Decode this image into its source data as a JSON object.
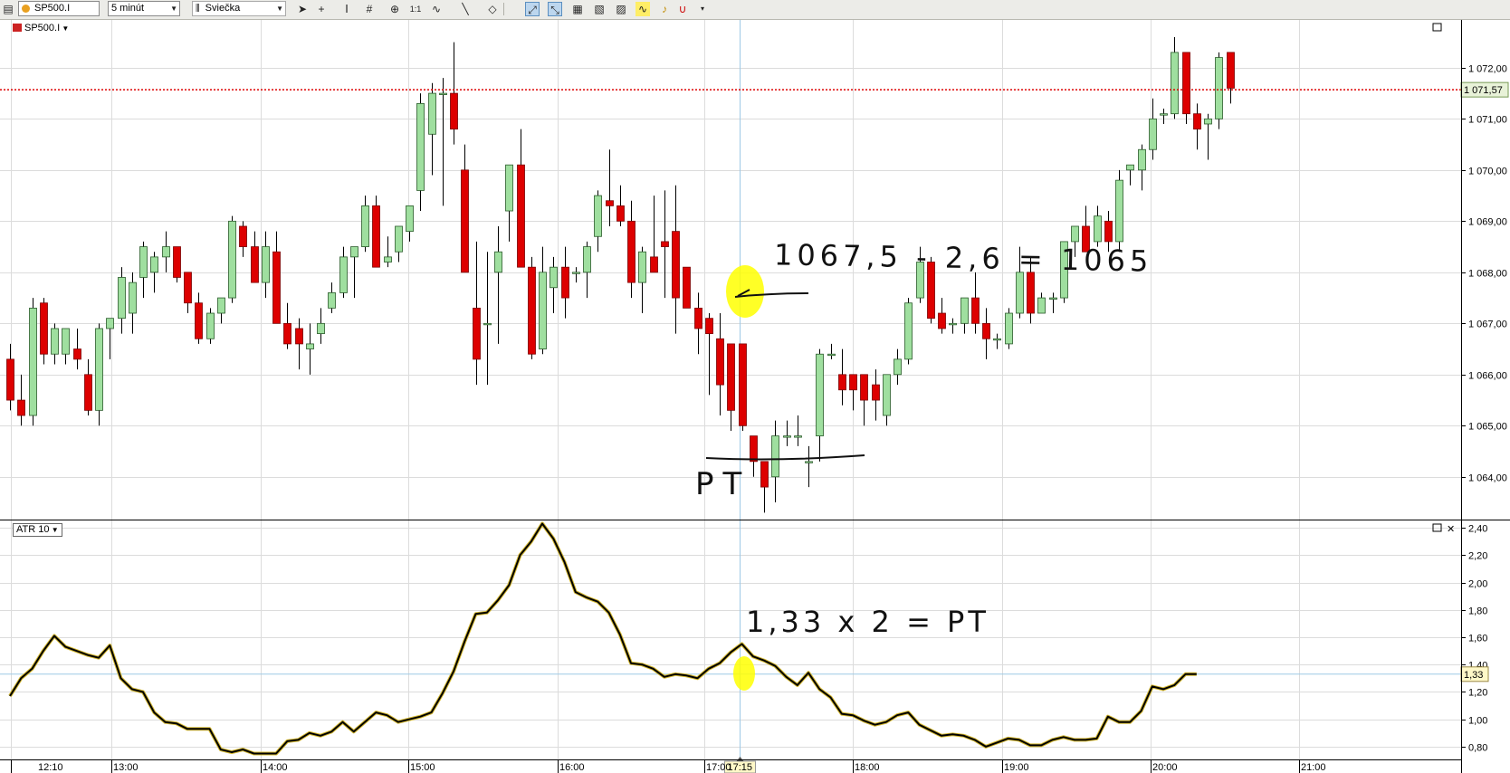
{
  "toolbar": {
    "symbol": "SP500.I",
    "timeframe": "5 minút",
    "chart_style": "Sviečka",
    "icons": [
      "ticket-icon",
      "cursor-icon",
      "crosshair-icon",
      "text-tool-icon",
      "grid-icon",
      "zoom-icon",
      "one-to-one-icon",
      "indicator-icon",
      "line-tool-icon",
      "eraser-icon",
      "auto-scale-icon",
      "auto-fit-icon",
      "template-icon",
      "compare-icon",
      "properties-icon",
      "indicator-list-icon",
      "alert-bell-icon",
      "magnet-icon",
      "more-icon"
    ]
  },
  "colors": {
    "bull": "#9fdf9f",
    "bear": "#dd0000",
    "price_line": "#dd0000",
    "crosshair": "#9ec9e6",
    "atr_line": "#d4b830",
    "highlight": "#ffff00",
    "grid": "#dcdcdc"
  },
  "price_pane": {
    "legend": "SP500.I",
    "last_price_label": "1 071,57",
    "handwriting_1": "1067,5 - 2,6 = 1065",
    "handwriting_2": "PT"
  },
  "atr_pane": {
    "legend": "ATR 10",
    "last_value_label": "1,33",
    "handwriting": "1,33 x 2 = PT"
  },
  "cursor_time_label": "17:15",
  "chart_data": [
    {
      "type": "candlestick",
      "title": "SP500.I",
      "timeframe": "5 minút",
      "x_ticks": [
        "12:10",
        "13:00",
        "14:00",
        "15:00",
        "16:00",
        "17:00",
        "18:00",
        "19:00",
        "20:00",
        "21:00"
      ],
      "ylim": [
        1063.2,
        1072.9
      ],
      "y_ticks": [
        "1 072,00",
        "1 071,00",
        "1 070,00",
        "1 069,00",
        "1 068,00",
        "1 067,00",
        "1 066,00",
        "1 065,00",
        "1 064,00"
      ],
      "y_tick_values": [
        1072,
        1071,
        1070,
        1069,
        1068,
        1067,
        1066,
        1065,
        1064
      ],
      "last_price": 1071.57,
      "crosshair_time": "17:15",
      "candles": [
        {
          "o": 1066.3,
          "h": 1066.6,
          "l": 1065.3,
          "c": 1065.5
        },
        {
          "o": 1065.5,
          "h": 1066.0,
          "l": 1065.0,
          "c": 1065.2
        },
        {
          "o": 1065.2,
          "h": 1067.5,
          "l": 1065.0,
          "c": 1067.3
        },
        {
          "o": 1067.4,
          "h": 1067.5,
          "l": 1066.2,
          "c": 1066.4
        },
        {
          "o": 1066.4,
          "h": 1067.0,
          "l": 1066.2,
          "c": 1066.9
        },
        {
          "o": 1066.4,
          "h": 1066.9,
          "l": 1066.2,
          "c": 1066.9
        },
        {
          "o": 1066.5,
          "h": 1066.9,
          "l": 1066.1,
          "c": 1066.3
        },
        {
          "o": 1066.0,
          "h": 1066.3,
          "l": 1065.2,
          "c": 1065.3
        },
        {
          "o": 1065.3,
          "h": 1067.0,
          "l": 1065.0,
          "c": 1066.9
        },
        {
          "o": 1066.9,
          "h": 1067.1,
          "l": 1066.3,
          "c": 1067.1
        },
        {
          "o": 1067.1,
          "h": 1068.1,
          "l": 1066.8,
          "c": 1067.9
        },
        {
          "o": 1067.2,
          "h": 1068.0,
          "l": 1066.8,
          "c": 1067.8
        },
        {
          "o": 1067.9,
          "h": 1068.6,
          "l": 1067.5,
          "c": 1068.5
        },
        {
          "o": 1068.0,
          "h": 1068.4,
          "l": 1067.6,
          "c": 1068.3
        },
        {
          "o": 1068.3,
          "h": 1068.8,
          "l": 1068.0,
          "c": 1068.5
        },
        {
          "o": 1068.5,
          "h": 1068.5,
          "l": 1067.8,
          "c": 1067.9
        },
        {
          "o": 1068.0,
          "h": 1068.0,
          "l": 1067.2,
          "c": 1067.4
        },
        {
          "o": 1067.4,
          "h": 1067.6,
          "l": 1066.6,
          "c": 1066.7
        },
        {
          "o": 1066.7,
          "h": 1067.3,
          "l": 1066.6,
          "c": 1067.2
        },
        {
          "o": 1067.2,
          "h": 1067.5,
          "l": 1067.0,
          "c": 1067.5
        },
        {
          "o": 1067.5,
          "h": 1069.1,
          "l": 1067.4,
          "c": 1069.0
        },
        {
          "o": 1068.9,
          "h": 1069.0,
          "l": 1068.3,
          "c": 1068.5
        },
        {
          "o": 1068.5,
          "h": 1068.8,
          "l": 1067.8,
          "c": 1067.8
        },
        {
          "o": 1067.8,
          "h": 1068.8,
          "l": 1067.5,
          "c": 1068.5
        },
        {
          "o": 1068.4,
          "h": 1068.8,
          "l": 1067.0,
          "c": 1067.0
        },
        {
          "o": 1067.0,
          "h": 1067.4,
          "l": 1066.5,
          "c": 1066.6
        },
        {
          "o": 1066.9,
          "h": 1067.1,
          "l": 1066.1,
          "c": 1066.6
        },
        {
          "o": 1066.5,
          "h": 1067.0,
          "l": 1066.0,
          "c": 1066.6
        },
        {
          "o": 1066.8,
          "h": 1067.3,
          "l": 1066.6,
          "c": 1067.0
        },
        {
          "o": 1067.3,
          "h": 1067.8,
          "l": 1067.2,
          "c": 1067.6
        },
        {
          "o": 1067.6,
          "h": 1068.5,
          "l": 1067.5,
          "c": 1068.3
        },
        {
          "o": 1068.3,
          "h": 1068.5,
          "l": 1067.5,
          "c": 1068.5
        },
        {
          "o": 1068.5,
          "h": 1069.5,
          "l": 1068.4,
          "c": 1069.3
        },
        {
          "o": 1069.3,
          "h": 1069.5,
          "l": 1068.4,
          "c": 1068.1
        },
        {
          "o": 1068.2,
          "h": 1068.7,
          "l": 1068.1,
          "c": 1068.3
        },
        {
          "o": 1068.4,
          "h": 1068.9,
          "l": 1068.2,
          "c": 1068.9
        },
        {
          "o": 1068.8,
          "h": 1069.3,
          "l": 1068.6,
          "c": 1069.3
        },
        {
          "o": 1069.6,
          "h": 1071.5,
          "l": 1069.2,
          "c": 1071.3
        },
        {
          "o": 1070.7,
          "h": 1071.7,
          "l": 1069.9,
          "c": 1071.5
        },
        {
          "o": 1071.5,
          "h": 1071.8,
          "l": 1069.3,
          "c": 1071.5
        },
        {
          "o": 1071.5,
          "h": 1072.5,
          "l": 1070.5,
          "c": 1070.8
        },
        {
          "o": 1070.0,
          "h": 1070.5,
          "l": 1068.0,
          "c": 1068.0
        },
        {
          "o": 1067.3,
          "h": 1068.6,
          "l": 1065.8,
          "c": 1066.3
        },
        {
          "o": 1067.0,
          "h": 1068.4,
          "l": 1065.8,
          "c": 1067.0
        },
        {
          "o": 1068.0,
          "h": 1068.9,
          "l": 1066.6,
          "c": 1068.4
        },
        {
          "o": 1069.2,
          "h": 1070.0,
          "l": 1068.6,
          "c": 1070.1
        },
        {
          "o": 1070.1,
          "h": 1070.8,
          "l": 1068.4,
          "c": 1068.1
        },
        {
          "o": 1068.1,
          "h": 1068.3,
          "l": 1066.3,
          "c": 1066.4
        },
        {
          "o": 1066.5,
          "h": 1068.5,
          "l": 1066.4,
          "c": 1068.0
        },
        {
          "o": 1067.7,
          "h": 1068.3,
          "l": 1067.2,
          "c": 1068.1
        },
        {
          "o": 1068.1,
          "h": 1068.5,
          "l": 1067.1,
          "c": 1067.5
        },
        {
          "o": 1068.0,
          "h": 1068.1,
          "l": 1067.8,
          "c": 1068.0
        },
        {
          "o": 1068.0,
          "h": 1068.6,
          "l": 1067.5,
          "c": 1068.5
        },
        {
          "o": 1068.7,
          "h": 1069.6,
          "l": 1068.4,
          "c": 1069.5
        },
        {
          "o": 1069.4,
          "h": 1070.4,
          "l": 1068.9,
          "c": 1069.3
        },
        {
          "o": 1069.3,
          "h": 1069.7,
          "l": 1068.9,
          "c": 1069.0
        },
        {
          "o": 1069.0,
          "h": 1069.4,
          "l": 1067.5,
          "c": 1067.8
        },
        {
          "o": 1067.8,
          "h": 1068.5,
          "l": 1067.2,
          "c": 1068.4
        },
        {
          "o": 1068.3,
          "h": 1069.5,
          "l": 1068.1,
          "c": 1068.0
        },
        {
          "o": 1068.6,
          "h": 1069.6,
          "l": 1067.5,
          "c": 1068.5
        },
        {
          "o": 1068.8,
          "h": 1069.7,
          "l": 1066.8,
          "c": 1067.5
        },
        {
          "o": 1068.1,
          "h": 1068.0,
          "l": 1067.3,
          "c": 1067.3
        },
        {
          "o": 1067.3,
          "h": 1067.6,
          "l": 1066.4,
          "c": 1066.9
        },
        {
          "o": 1067.1,
          "h": 1067.2,
          "l": 1065.6,
          "c": 1066.8
        },
        {
          "o": 1066.7,
          "h": 1067.2,
          "l": 1065.2,
          "c": 1065.8
        },
        {
          "o": 1066.6,
          "h": 1066.6,
          "l": 1064.9,
          "c": 1065.3
        },
        {
          "o": 1066.6,
          "h": 1066.6,
          "l": 1064.9,
          "c": 1065.0
        },
        {
          "o": 1064.8,
          "h": 1064.8,
          "l": 1064.0,
          "c": 1064.3
        },
        {
          "o": 1064.3,
          "h": 1064.3,
          "l": 1063.3,
          "c": 1063.8
        },
        {
          "o": 1064.0,
          "h": 1065.1,
          "l": 1063.5,
          "c": 1064.8
        },
        {
          "o": 1064.8,
          "h": 1065.1,
          "l": 1064.6,
          "c": 1064.8
        },
        {
          "o": 1064.8,
          "h": 1065.2,
          "l": 1064.6,
          "c": 1064.8
        },
        {
          "o": 1064.3,
          "h": 1064.6,
          "l": 1063.8,
          "c": 1064.3
        },
        {
          "o": 1064.8,
          "h": 1066.5,
          "l": 1064.3,
          "c": 1066.4
        },
        {
          "o": 1066.4,
          "h": 1066.6,
          "l": 1066.3,
          "c": 1066.4
        },
        {
          "o": 1066.0,
          "h": 1066.5,
          "l": 1065.4,
          "c": 1065.7
        },
        {
          "o": 1066.0,
          "h": 1066.0,
          "l": 1065.3,
          "c": 1065.7
        },
        {
          "o": 1066.0,
          "h": 1066.0,
          "l": 1065.0,
          "c": 1065.5
        },
        {
          "o": 1065.8,
          "h": 1066.1,
          "l": 1065.1,
          "c": 1065.5
        },
        {
          "o": 1065.2,
          "h": 1066.0,
          "l": 1065.0,
          "c": 1066.0
        },
        {
          "o": 1066.0,
          "h": 1066.5,
          "l": 1065.8,
          "c": 1066.3
        },
        {
          "o": 1066.3,
          "h": 1067.5,
          "l": 1066.2,
          "c": 1067.4
        },
        {
          "o": 1067.5,
          "h": 1068.5,
          "l": 1067.4,
          "c": 1068.2
        },
        {
          "o": 1068.2,
          "h": 1068.3,
          "l": 1067.0,
          "c": 1067.1
        },
        {
          "o": 1067.2,
          "h": 1067.5,
          "l": 1066.8,
          "c": 1066.9
        },
        {
          "o": 1067.0,
          "h": 1067.1,
          "l": 1066.8,
          "c": 1067.0
        },
        {
          "o": 1067.0,
          "h": 1067.5,
          "l": 1066.8,
          "c": 1067.5
        },
        {
          "o": 1067.5,
          "h": 1068.0,
          "l": 1066.8,
          "c": 1067.0
        },
        {
          "o": 1067.0,
          "h": 1067.3,
          "l": 1066.3,
          "c": 1066.7
        },
        {
          "o": 1066.7,
          "h": 1066.8,
          "l": 1066.5,
          "c": 1066.7
        },
        {
          "o": 1066.6,
          "h": 1067.3,
          "l": 1066.5,
          "c": 1067.2
        },
        {
          "o": 1067.2,
          "h": 1068.5,
          "l": 1067.1,
          "c": 1068.0
        },
        {
          "o": 1068.0,
          "h": 1068.3,
          "l": 1067.0,
          "c": 1067.2
        },
        {
          "o": 1067.2,
          "h": 1067.6,
          "l": 1067.2,
          "c": 1067.5
        },
        {
          "o": 1067.5,
          "h": 1067.6,
          "l": 1067.2,
          "c": 1067.5
        },
        {
          "o": 1067.5,
          "h": 1068.6,
          "l": 1067.4,
          "c": 1068.6
        },
        {
          "o": 1068.6,
          "h": 1068.9,
          "l": 1068.3,
          "c": 1068.9
        },
        {
          "o": 1068.9,
          "h": 1069.3,
          "l": 1068.4,
          "c": 1068.4
        },
        {
          "o": 1068.6,
          "h": 1069.3,
          "l": 1068.5,
          "c": 1069.1
        },
        {
          "o": 1069.0,
          "h": 1069.2,
          "l": 1068.4,
          "c": 1068.6
        },
        {
          "o": 1068.6,
          "h": 1070.0,
          "l": 1068.4,
          "c": 1069.8
        },
        {
          "o": 1070.0,
          "h": 1070.1,
          "l": 1069.7,
          "c": 1070.1
        },
        {
          "o": 1070.0,
          "h": 1070.5,
          "l": 1069.6,
          "c": 1070.4
        },
        {
          "o": 1070.4,
          "h": 1071.4,
          "l": 1070.2,
          "c": 1071.0
        },
        {
          "o": 1071.1,
          "h": 1071.2,
          "l": 1070.9,
          "c": 1071.1
        },
        {
          "o": 1071.1,
          "h": 1072.6,
          "l": 1071.0,
          "c": 1072.3
        },
        {
          "o": 1072.3,
          "h": 1072.3,
          "l": 1070.9,
          "c": 1071.1
        },
        {
          "o": 1071.1,
          "h": 1071.3,
          "l": 1070.4,
          "c": 1070.8
        },
        {
          "o": 1070.9,
          "h": 1071.1,
          "l": 1070.2,
          "c": 1071.0
        },
        {
          "o": 1071.0,
          "h": 1072.3,
          "l": 1070.8,
          "c": 1072.2
        },
        {
          "o": 1072.3,
          "h": 1072.3,
          "l": 1071.3,
          "c": 1071.6
        }
      ]
    },
    {
      "type": "line",
      "title": "ATR 10",
      "ylim": [
        0.74,
        2.44
      ],
      "y_ticks": [
        "2,40",
        "2,20",
        "2,00",
        "1,80",
        "1,60",
        "1,40",
        "1,20",
        "1,00",
        "0,80"
      ],
      "y_tick_values": [
        2.4,
        2.2,
        2.0,
        1.8,
        1.6,
        1.4,
        1.2,
        1.0,
        0.8
      ],
      "last_value": 1.33,
      "values": [
        1.17,
        1.3,
        1.37,
        1.5,
        1.61,
        1.53,
        1.5,
        1.47,
        1.45,
        1.54,
        1.3,
        1.22,
        1.2,
        1.05,
        0.98,
        0.97,
        0.93,
        0.93,
        0.93,
        0.78,
        0.76,
        0.78,
        0.75,
        0.75,
        0.75,
        0.84,
        0.85,
        0.9,
        0.88,
        0.91,
        0.98,
        0.91,
        0.98,
        1.05,
        1.03,
        0.98,
        1.0,
        1.02,
        1.05,
        1.19,
        1.35,
        1.57,
        1.77,
        1.78,
        1.87,
        1.98,
        2.2,
        2.3,
        2.43,
        2.32,
        2.15,
        1.93,
        1.89,
        1.86,
        1.78,
        1.62,
        1.41,
        1.4,
        1.37,
        1.31,
        1.33,
        1.32,
        1.3,
        1.37,
        1.41,
        1.49,
        1.55,
        1.46,
        1.43,
        1.39,
        1.31,
        1.25,
        1.34,
        1.22,
        1.16,
        1.04,
        1.03,
        0.99,
        0.96,
        0.98,
        1.03,
        1.05,
        0.96,
        0.92,
        0.88,
        0.89,
        0.88,
        0.85,
        0.8,
        0.83,
        0.86,
        0.85,
        0.81,
        0.81,
        0.85,
        0.87,
        0.85,
        0.85,
        0.86,
        1.02,
        0.98,
        0.98,
        1.06,
        1.24,
        1.22,
        1.25,
        1.33,
        1.33
      ]
    }
  ]
}
